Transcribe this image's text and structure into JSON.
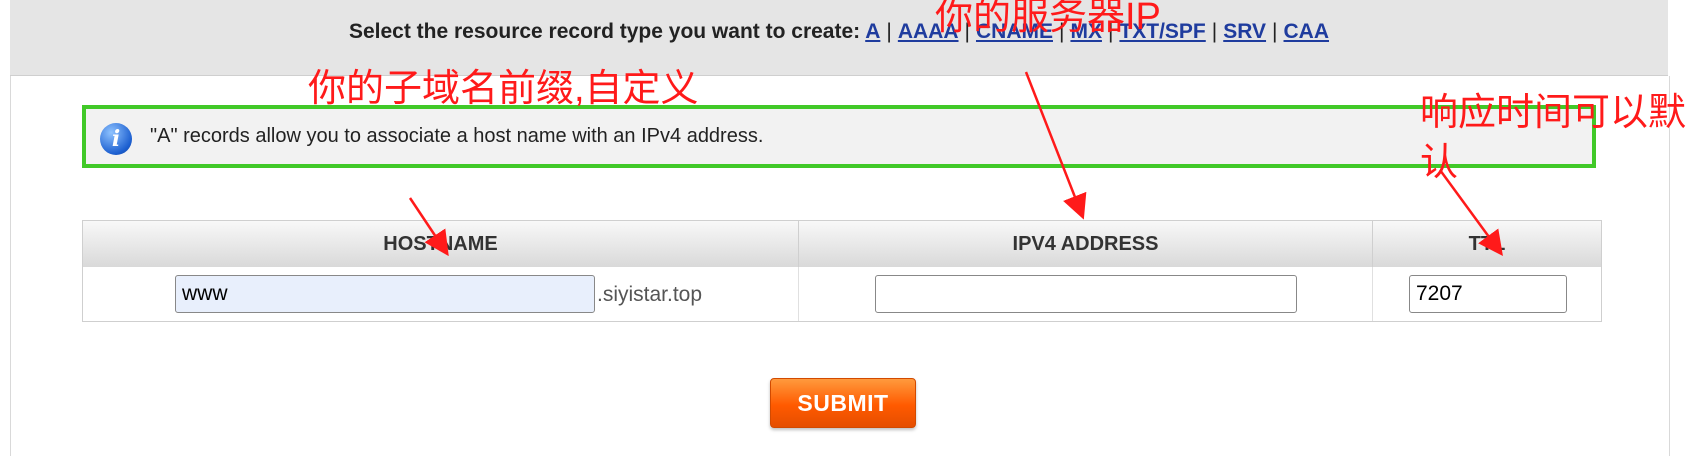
{
  "header": {
    "prompt": "Select the resource record type you want to create:",
    "record_types": [
      "A",
      "AAAA",
      "CNAME",
      "MX",
      "TXT/SPF",
      "SRV",
      "CAA"
    ],
    "separator": "|"
  },
  "info": {
    "icon": "info-icon",
    "text": "\"A\" records allow you to associate a host name with an IPv4 address."
  },
  "table": {
    "columns": [
      "HOSTNAME",
      "IPV4 ADDRESS",
      "TTL"
    ],
    "hostname_value": "www",
    "domain_suffix": ".siyistar.top",
    "ipv4_value": "",
    "ttl_value": "7207"
  },
  "submit_label": "SUBMIT",
  "annotations": {
    "server_ip": "你的服务器IP",
    "subdomain": "你的子域名前缀,自定义",
    "ttl": "响应时间可以默认"
  },
  "colors": {
    "annotation": "#ff1a1a",
    "info_border": "#41c928",
    "link": "#1f3c9e",
    "submit": "#ff5a00"
  }
}
